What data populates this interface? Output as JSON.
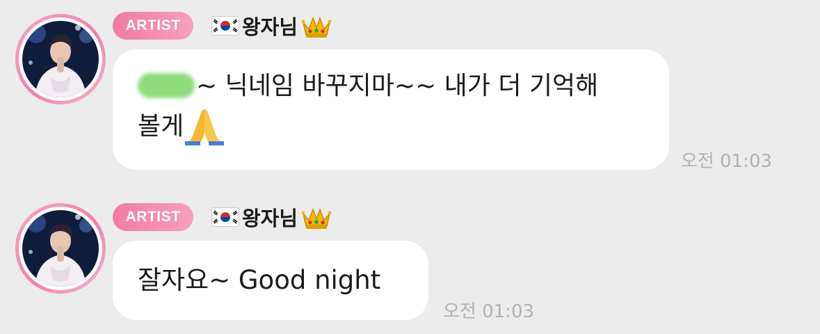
{
  "messages": [
    {
      "badge": "ARTIST",
      "sender_name": "왕자님",
      "flag_icon": "korea-flag-icon",
      "crown_icon": "crown-icon",
      "text_blurred_part": "",
      "text_main": "~ 닉네임 바꾸지마~~ 내가 더 기억해",
      "text_line2": "볼게",
      "emoji": "folded-hands-icon",
      "time": "오전 01:03"
    },
    {
      "badge": "ARTIST",
      "sender_name": "왕자님",
      "flag_icon": "korea-flag-icon",
      "crown_icon": "crown-icon",
      "text": "잘자요~ Good night",
      "time": "오전 01:03"
    }
  ],
  "colors": {
    "background": "#ececec",
    "bubble": "#ffffff",
    "badge_gradient_start": "#f17ba4",
    "badge_gradient_end": "#f6a0bc",
    "avatar_ring": "#f07fae",
    "time_text": "#b2b2b2"
  }
}
